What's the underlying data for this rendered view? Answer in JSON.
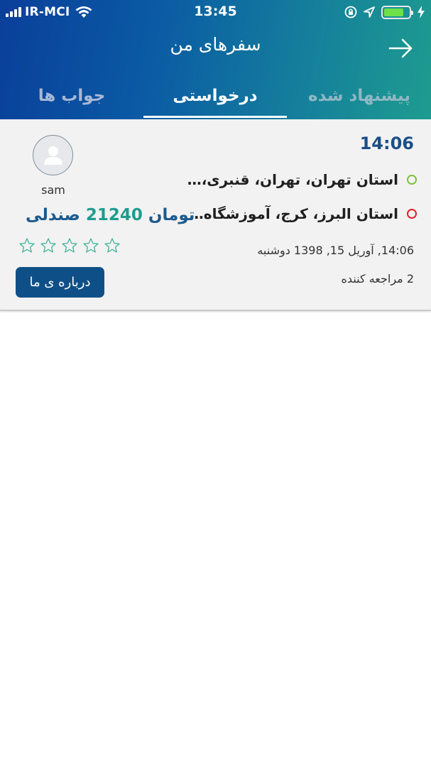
{
  "status_bar": {
    "carrier": "IR-MCI",
    "time": "13:45"
  },
  "header": {
    "title": "سفرهای من",
    "back_icon": "arrow-right-icon"
  },
  "tabs": [
    {
      "label": "پیشنهاد شده",
      "active": false
    },
    {
      "label": "درخواستی",
      "active": true
    },
    {
      "label": "جواب ها",
      "active": false
    }
  ],
  "trip": {
    "time": "14:06",
    "origin": "استان تهران، تهران، قنبری، ایران",
    "destination": "استان البرز، کرج، آموزشگاه مو...",
    "date": "14:06, آوریل 15, 1398  دوشنبه",
    "referrals": "2 مراجعه کننده",
    "user": "sam",
    "price_label": "تومان",
    "price_amount": "21240",
    "seat_label": "صندلی",
    "rating": 0,
    "about_button": "درباره ی ما"
  },
  "colors": {
    "header_start": "#0a3f9a",
    "header_end": "#1e9c8f",
    "accent_blue": "#1b4f86",
    "accent_teal": "#1e9c8f",
    "origin_dot": "#7cc13a",
    "destination_dot": "#e0202a",
    "button_bg": "#0f4f88"
  }
}
